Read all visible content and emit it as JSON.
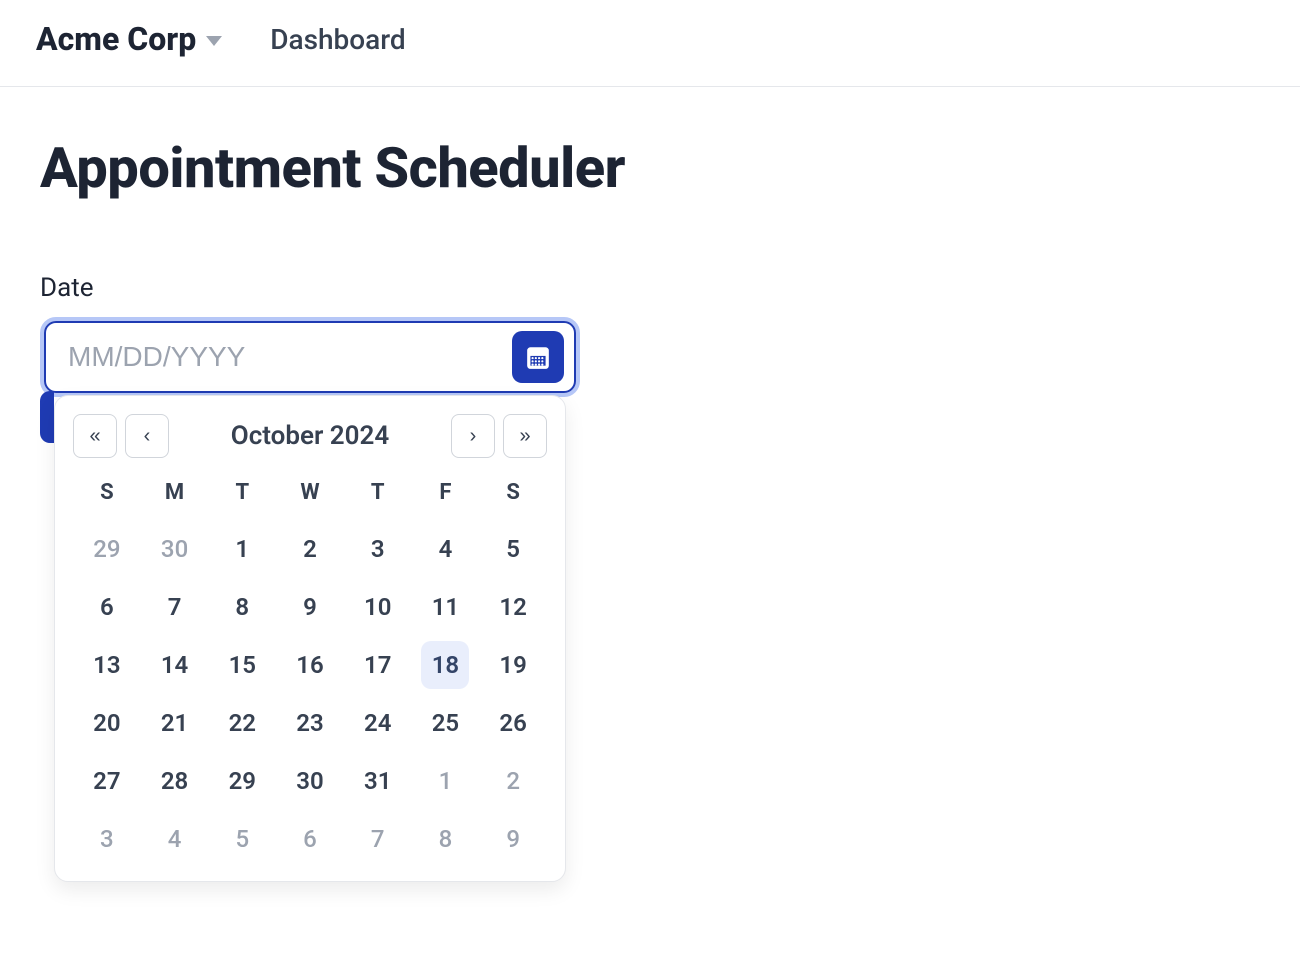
{
  "header": {
    "org_name": "Acme Corp",
    "nav_dashboard": "Dashboard"
  },
  "page": {
    "title": "Appointment Scheduler"
  },
  "date_field": {
    "label": "Date",
    "placeholder": "MM/DD/YYYY",
    "value": ""
  },
  "calendar": {
    "month_label": "October 2024",
    "dow": [
      "S",
      "M",
      "T",
      "W",
      "T",
      "F",
      "S"
    ],
    "today": 18,
    "weeks": [
      [
        {
          "d": 29,
          "outside": true
        },
        {
          "d": 30,
          "outside": true
        },
        {
          "d": 1,
          "outside": false
        },
        {
          "d": 2,
          "outside": false
        },
        {
          "d": 3,
          "outside": false
        },
        {
          "d": 4,
          "outside": false
        },
        {
          "d": 5,
          "outside": false
        }
      ],
      [
        {
          "d": 6,
          "outside": false
        },
        {
          "d": 7,
          "outside": false
        },
        {
          "d": 8,
          "outside": false
        },
        {
          "d": 9,
          "outside": false
        },
        {
          "d": 10,
          "outside": false
        },
        {
          "d": 11,
          "outside": false
        },
        {
          "d": 12,
          "outside": false
        }
      ],
      [
        {
          "d": 13,
          "outside": false
        },
        {
          "d": 14,
          "outside": false
        },
        {
          "d": 15,
          "outside": false
        },
        {
          "d": 16,
          "outside": false
        },
        {
          "d": 17,
          "outside": false
        },
        {
          "d": 18,
          "outside": false
        },
        {
          "d": 19,
          "outside": false
        }
      ],
      [
        {
          "d": 20,
          "outside": false
        },
        {
          "d": 21,
          "outside": false
        },
        {
          "d": 22,
          "outside": false
        },
        {
          "d": 23,
          "outside": false
        },
        {
          "d": 24,
          "outside": false
        },
        {
          "d": 25,
          "outside": false
        },
        {
          "d": 26,
          "outside": false
        }
      ],
      [
        {
          "d": 27,
          "outside": false
        },
        {
          "d": 28,
          "outside": false
        },
        {
          "d": 29,
          "outside": false
        },
        {
          "d": 30,
          "outside": false
        },
        {
          "d": 31,
          "outside": false
        },
        {
          "d": 1,
          "outside": true
        },
        {
          "d": 2,
          "outside": true
        }
      ],
      [
        {
          "d": 3,
          "outside": true
        },
        {
          "d": 4,
          "outside": true
        },
        {
          "d": 5,
          "outside": true
        },
        {
          "d": 6,
          "outside": true
        },
        {
          "d": 7,
          "outside": true
        },
        {
          "d": 8,
          "outside": true
        },
        {
          "d": 9,
          "outside": true
        }
      ]
    ]
  }
}
